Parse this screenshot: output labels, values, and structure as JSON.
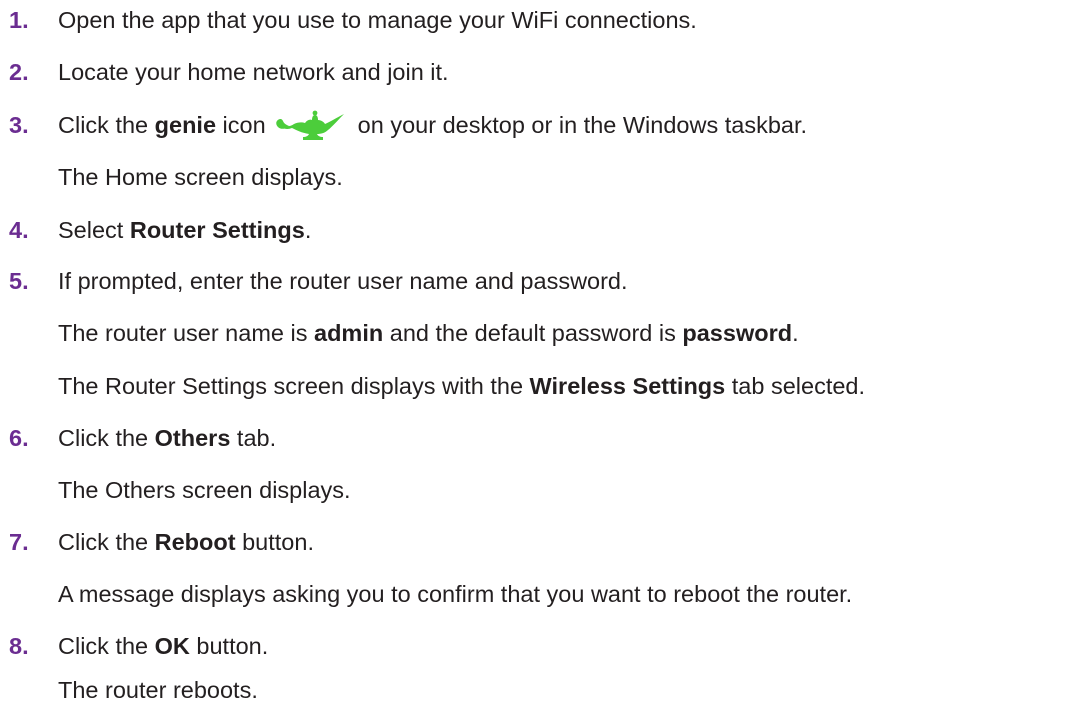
{
  "steps": [
    {
      "number": "1.",
      "text": "Open the app that you use to manage your WiFi connections."
    },
    {
      "number": "2.",
      "text": "Locate your home network and join it."
    },
    {
      "number": "3.",
      "pre": "Click the ",
      "bold": "genie",
      "mid": " icon",
      "post": "on your desktop or in the Windows taskbar.",
      "icon": "genie-lamp-icon",
      "icon_color": "#4ccd3b",
      "result": "The Home screen displays."
    },
    {
      "number": "4.",
      "pre": "Select ",
      "bold": "Router Settings",
      "post": "."
    },
    {
      "number": "5.",
      "text": "If prompted, enter the router user name and password.",
      "detail": {
        "pre": "The router user name is ",
        "bold1": "admin",
        "mid": " and the default password is ",
        "bold2": "password",
        "post": "."
      },
      "result": {
        "pre": "The Router Settings screen displays with the ",
        "bold": "Wireless Settings",
        "post": " tab selected."
      }
    },
    {
      "number": "6.",
      "pre": "Click the ",
      "bold": "Others",
      "post": " tab.",
      "result": "The Others screen displays."
    },
    {
      "number": "7.",
      "pre": "Click the ",
      "bold": "Reboot",
      "post": " button.",
      "result": "A message displays asking you to confirm that you want to reboot the router."
    },
    {
      "number": "8.",
      "pre": "Click the ",
      "bold": "OK",
      "post": " button.",
      "result": "The router reboots."
    }
  ],
  "colors": {
    "step_number": "#6b2d91",
    "text": "#231f20"
  }
}
